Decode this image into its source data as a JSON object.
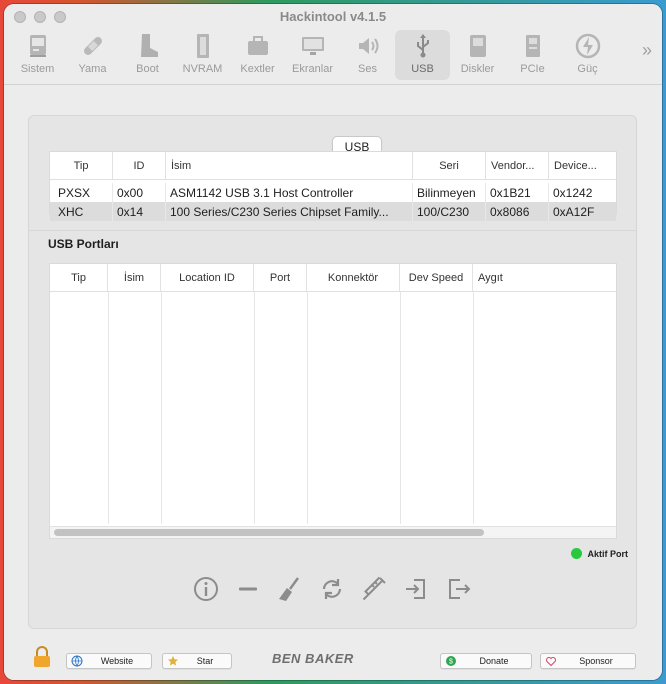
{
  "window": {
    "title": "Hackintool v4.1.5"
  },
  "toolbar": {
    "items": [
      {
        "label": "Sistem",
        "icon": "computer-icon"
      },
      {
        "label": "Yama",
        "icon": "bandage-icon"
      },
      {
        "label": "Boot",
        "icon": "boot-icon"
      },
      {
        "label": "NVRAM",
        "icon": "memory-chip-icon"
      },
      {
        "label": "Kextler",
        "icon": "toolbox-icon"
      },
      {
        "label": "Ekranlar",
        "icon": "monitor-icon"
      },
      {
        "label": "Ses",
        "icon": "speaker-icon"
      },
      {
        "label": "USB",
        "icon": "usb-icon"
      },
      {
        "label": "Diskler",
        "icon": "disk-icon"
      },
      {
        "label": "PCIe",
        "icon": "pcie-card-icon"
      },
      {
        "label": "Güç",
        "icon": "power-bolt-icon"
      }
    ],
    "active": "USB",
    "more": "»"
  },
  "segment": {
    "label": "USB"
  },
  "controllers": {
    "columns": [
      "Tip",
      "ID",
      "İsim",
      "Seri",
      "Vendor...",
      "Device..."
    ],
    "rows": [
      [
        "PXSX",
        "0x00",
        "ASM1142 USB 3.1 Host Controller",
        "Bilinmeyen",
        "0x1B21",
        "0x1242"
      ],
      [
        "XHC",
        "0x14",
        "100 Series/C230 Series Chipset Family...",
        "100/C230",
        "0x8086",
        "0xA12F"
      ]
    ],
    "selected_row": 1
  },
  "ports": {
    "title": "USB Portları",
    "columns": [
      "Tip",
      "İsim",
      "Location ID",
      "Port",
      "Konnektör",
      "Dev Speed",
      "Aygıt"
    ]
  },
  "legend": {
    "label": "Aktif Port",
    "color": "#28c840"
  },
  "actions": [
    "info-icon",
    "minus-icon",
    "broom-icon",
    "refresh-icon",
    "syringe-icon",
    "import-icon",
    "export-icon"
  ],
  "footer": {
    "website": "Website",
    "star": "Star",
    "brand": "BEN BAKER",
    "donate": "Donate",
    "sponsor": "Sponsor"
  }
}
